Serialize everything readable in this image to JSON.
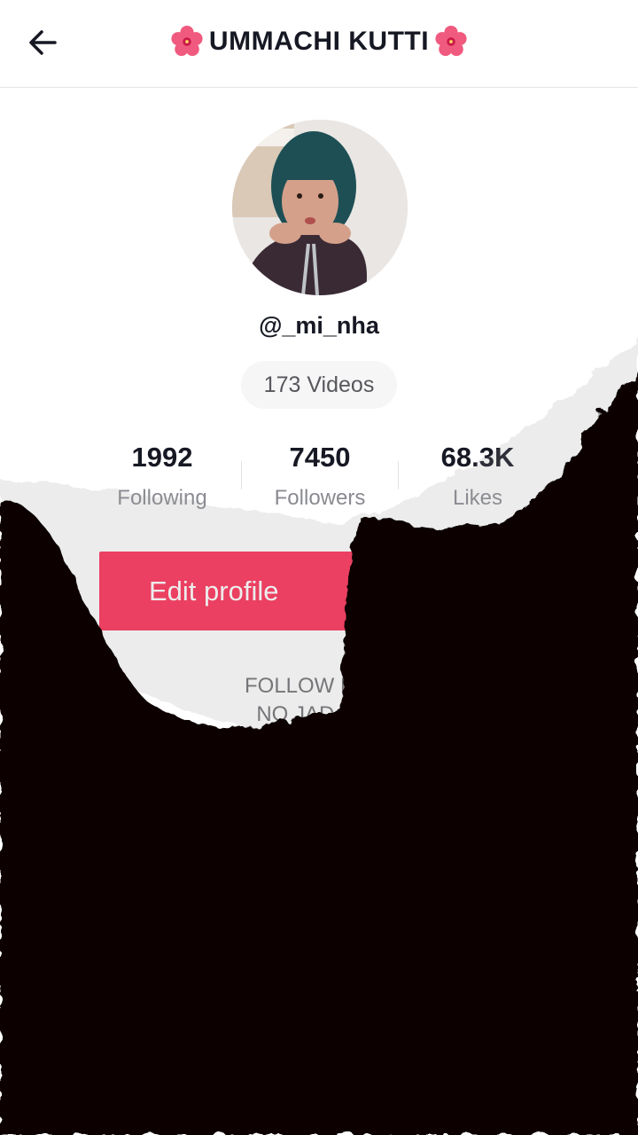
{
  "header": {
    "title": "UMMACHI KUTTI",
    "back_icon": "arrow-left-icon",
    "decoration_icon": "hibiscus-flower-icon"
  },
  "profile": {
    "avatar_alt": "profile-photo",
    "handle": "@_mi_nha",
    "videos_label": "173 Videos"
  },
  "stats": [
    {
      "value": "1992",
      "label": "Following"
    },
    {
      "value": "7450",
      "label": "Followers"
    },
    {
      "value": "68.3K",
      "label": "Likes"
    }
  ],
  "actions": {
    "edit_profile_label": "Edit profile"
  },
  "bio": {
    "line1": "FOLLOW ME C",
    "line2": "NO JADA FU"
  },
  "colors": {
    "accent": "#fe2c55",
    "text_primary": "#161823",
    "text_secondary": "#8a8b91",
    "overlay": "#070304"
  }
}
